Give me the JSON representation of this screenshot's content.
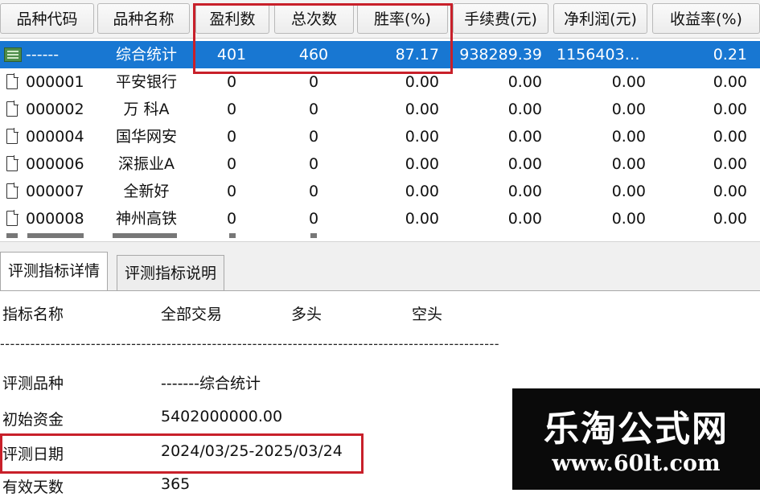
{
  "columns": [
    "品种代码",
    "品种名称",
    "盈利数",
    "总次数",
    "胜率(%)",
    "手续费(元)",
    "净利润(元)",
    "收益率(%)"
  ],
  "summary_row": {
    "code": "------",
    "name": "综合统计",
    "wins": "401",
    "total": "460",
    "rate": "87.17",
    "fee": "938289.39",
    "net": "1156403…",
    "ret": "0.21"
  },
  "rows": [
    {
      "code": "000001",
      "name": "平安银行",
      "wins": "0",
      "total": "0",
      "rate": "0.00",
      "fee": "0.00",
      "net": "0.00",
      "ret": "0.00"
    },
    {
      "code": "000002",
      "name": "万 科A",
      "wins": "0",
      "total": "0",
      "rate": "0.00",
      "fee": "0.00",
      "net": "0.00",
      "ret": "0.00"
    },
    {
      "code": "000004",
      "name": "国华网安",
      "wins": "0",
      "total": "0",
      "rate": "0.00",
      "fee": "0.00",
      "net": "0.00",
      "ret": "0.00"
    },
    {
      "code": "000006",
      "name": "深振业A",
      "wins": "0",
      "total": "0",
      "rate": "0.00",
      "fee": "0.00",
      "net": "0.00",
      "ret": "0.00"
    },
    {
      "code": "000007",
      "name": "全新好",
      "wins": "0",
      "total": "0",
      "rate": "0.00",
      "fee": "0.00",
      "net": "0.00",
      "ret": "0.00"
    },
    {
      "code": "000008",
      "name": "神州高铁",
      "wins": "0",
      "total": "0",
      "rate": "0.00",
      "fee": "0.00",
      "net": "0.00",
      "ret": "0.00"
    }
  ],
  "tabs": [
    "评测指标详情",
    "评测指标说明"
  ],
  "details": {
    "header": {
      "name": "指标名称",
      "all": "全部交易",
      "long": "多头",
      "short": "空头"
    },
    "dashes": "----------------------------------------------------------------------------------------------------",
    "items": [
      {
        "label": "评测品种",
        "value": "-------综合统计"
      },
      {
        "label": "初始资金",
        "value": "5402000000.00"
      },
      {
        "label": "评测日期",
        "value": "2024/03/25-2025/03/24"
      },
      {
        "label": "有效天数",
        "value": "365"
      }
    ]
  },
  "watermark": {
    "title": "乐淘公式网",
    "url": "www.60lt.com"
  },
  "colors": {
    "selected_row": "#1877d2",
    "highlight_box": "#c8202a",
    "watermark_bg": "#0a0a0a"
  }
}
